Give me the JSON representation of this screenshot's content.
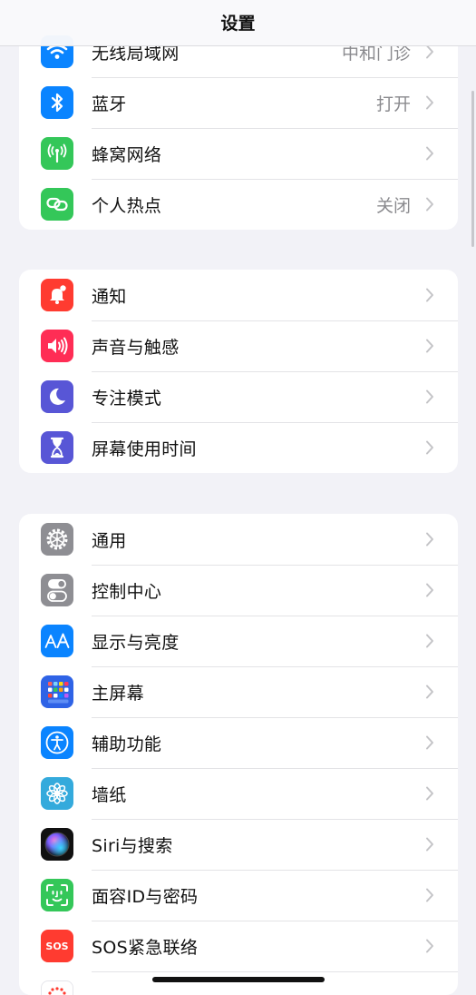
{
  "nav": {
    "title": "设置"
  },
  "groups": [
    {
      "rows": [
        {
          "label": "无线局域网",
          "value": "中和门诊",
          "icon": "wifi-icon",
          "color": "#0a84ff"
        },
        {
          "label": "蓝牙",
          "value": "打开",
          "icon": "bluetooth-icon",
          "color": "#0a84ff"
        },
        {
          "label": "蜂窝网络",
          "value": "",
          "icon": "cellular-antenna-icon",
          "color": "#34c759"
        },
        {
          "label": "个人热点",
          "value": "关闭",
          "icon": "personal-hotspot-icon",
          "color": "#34c759"
        }
      ]
    },
    {
      "rows": [
        {
          "label": "通知",
          "icon": "notification-bell-icon",
          "color": "#ff3b30"
        },
        {
          "label": "声音与触感",
          "icon": "speaker-icon",
          "color": "#ff2d55"
        },
        {
          "label": "专注模式",
          "icon": "moon-icon",
          "color": "#5856d6"
        },
        {
          "label": "屏幕使用时间",
          "icon": "hourglass-icon",
          "color": "#5856d6"
        }
      ]
    },
    {
      "rows": [
        {
          "label": "通用",
          "icon": "gear-icon",
          "color": "#8e8e93"
        },
        {
          "label": "控制中心",
          "icon": "toggles-icon",
          "color": "#8e8e93"
        },
        {
          "label": "显示与亮度",
          "icon": "text-size-icon",
          "color": "#0a84ff"
        },
        {
          "label": "主屏幕",
          "icon": "app-grid-icon",
          "color": "#2f63e6"
        },
        {
          "label": "辅助功能",
          "icon": "accessibility-icon",
          "color": "#0a84ff"
        },
        {
          "label": "墙纸",
          "icon": "flower-icon",
          "color": "#34aadc"
        },
        {
          "label": "Siri与搜索",
          "icon": "siri-orb-icon",
          "color": "#111111"
        },
        {
          "label": "面容ID与密码",
          "icon": "face-id-icon",
          "color": "#34c759"
        },
        {
          "label": "SOS紧急联络",
          "icon": "sos-icon",
          "color": "#ff3b30",
          "icon_text": "SOS"
        }
      ]
    }
  ]
}
